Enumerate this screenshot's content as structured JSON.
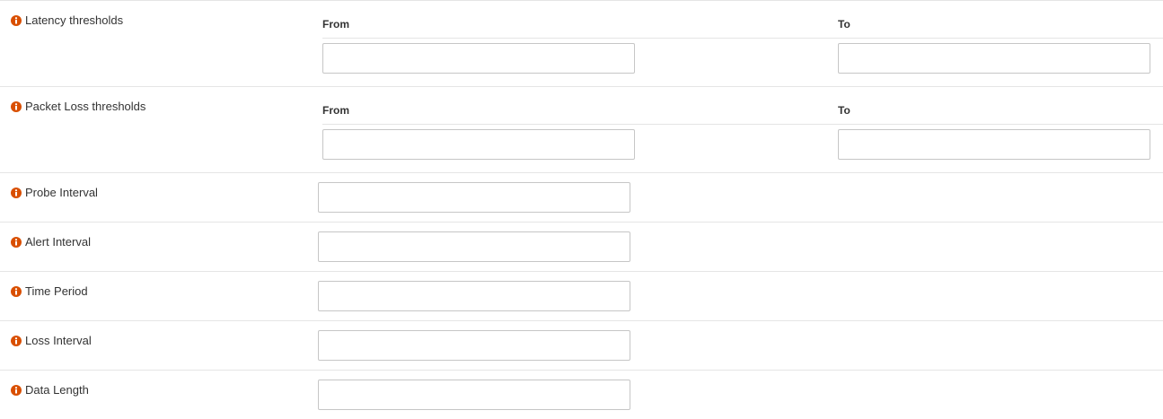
{
  "accent_color": "#d94f00",
  "columns": {
    "from_label": "From",
    "to_label": "To"
  },
  "thresholds": [
    {
      "id": "latency",
      "label": "Latency thresholds",
      "icon": "info-icon",
      "from_value": "",
      "to_value": ""
    },
    {
      "id": "packet-loss",
      "label": "Packet Loss thresholds",
      "icon": "info-icon",
      "from_value": "",
      "to_value": ""
    }
  ],
  "fields": [
    {
      "id": "probe-interval",
      "label": "Probe Interval",
      "icon": "info-icon",
      "value": ""
    },
    {
      "id": "alert-interval",
      "label": "Alert Interval",
      "icon": "info-icon",
      "value": ""
    },
    {
      "id": "time-period",
      "label": "Time Period",
      "icon": "info-icon",
      "value": ""
    },
    {
      "id": "loss-interval",
      "label": "Loss Interval",
      "icon": "info-icon",
      "value": ""
    },
    {
      "id": "data-length",
      "label": "Data Length",
      "icon": "info-icon",
      "value": ""
    }
  ]
}
